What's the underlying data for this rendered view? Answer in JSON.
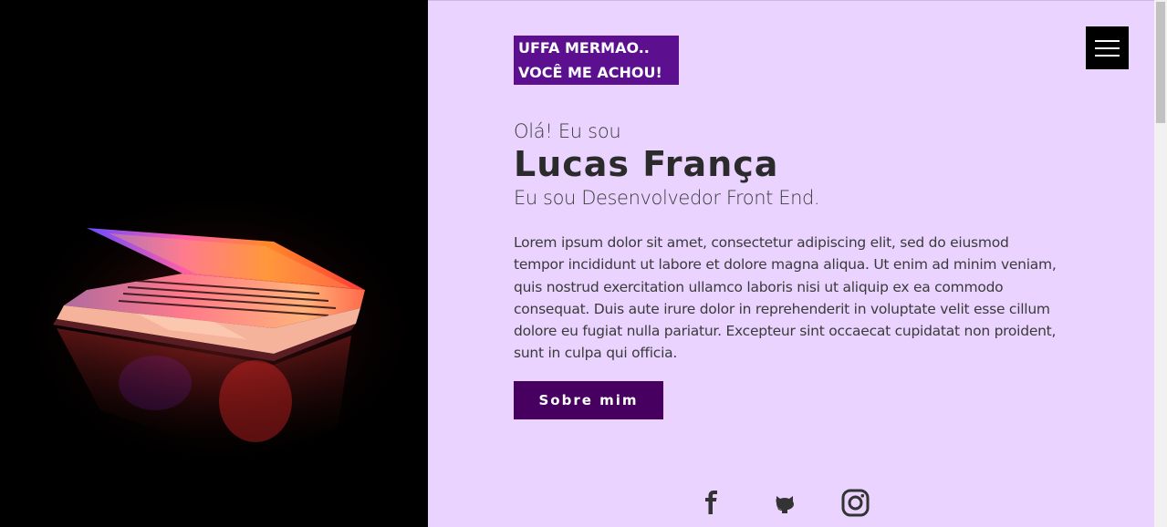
{
  "hero": {
    "image_alt": "laptop",
    "accent_colors": [
      "#ff3a3a",
      "#ff8a2a",
      "#6a4bff",
      "#ff5fa8"
    ]
  },
  "badge": {
    "line1": "UFFA MERMAO..",
    "line2": "VOCÊ ME ACHOU!",
    "color": "#5c0f8f"
  },
  "menu": {
    "icon": "hamburger-icon"
  },
  "intro": {
    "greeting": "Olá! Eu sou",
    "name": "Lucas França",
    "role": "Eu sou Desenvolvedor Front End."
  },
  "bio": "Lorem ipsum dolor sit amet, consectetur adipiscing elit, sed do eiusmod tempor incididunt ut labore et dolore magna aliqua. Ut enim ad minim veniam, quis nostrud exercitation ullamco laboris nisi ut aliquip ex ea commodo consequat. Duis aute irure dolor in reprehenderit in voluptate velit esse cillum dolore eu fugiat nulla pariatur. Excepteur sint occaecat cupidatat non proident, sunt in culpa qui officia.",
  "cta": {
    "label": "Sobre mim",
    "color": "#47005f"
  },
  "social": [
    {
      "icon": "facebook-icon"
    },
    {
      "icon": "github-icon"
    },
    {
      "icon": "instagram-icon"
    }
  ],
  "theme": {
    "background": "#ead4ff",
    "text": "#2b2b2b"
  }
}
